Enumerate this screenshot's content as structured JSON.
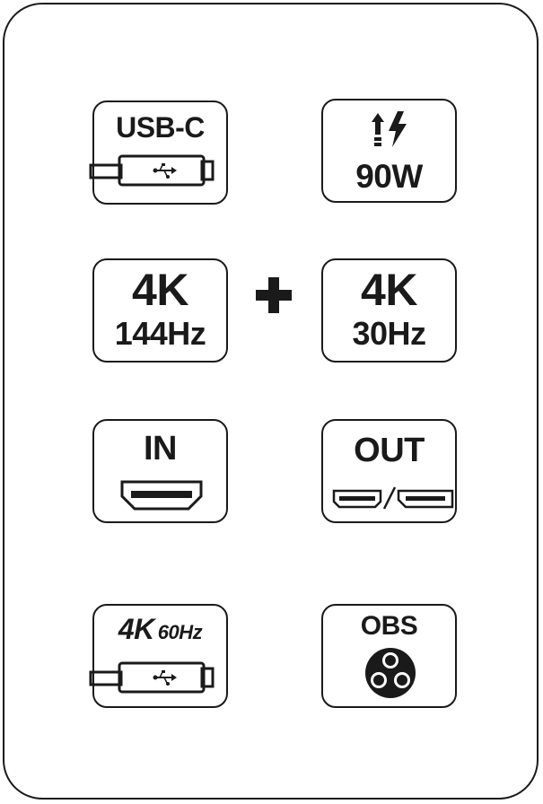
{
  "tiles": {
    "usb_c": {
      "label": "USB-C"
    },
    "power": {
      "label": "90W"
    },
    "display1": {
      "line1": "4K",
      "line2": "144Hz"
    },
    "plus": {
      "symbol": "+"
    },
    "display2": {
      "line1": "4K",
      "line2": "30Hz"
    },
    "hdmi_in": {
      "label": "IN"
    },
    "output": {
      "label": "OUT",
      "separator": "/"
    },
    "usb_4k60": {
      "label_main": "4K",
      "label_rate": "60Hz"
    },
    "obs": {
      "label": "OBS"
    }
  },
  "icons": {
    "usb_c": "usb-c-cable-icon",
    "power": "upload-power-bolt-icon",
    "hdmi_in": "hdmi-port-icon",
    "output": "hdmi-and-displayport-icon",
    "usb_4k60": "usb-c-cable-icon",
    "obs": "obs-logo-icon"
  },
  "colors": {
    "ink": "#1a1a1a",
    "background": "#ffffff"
  }
}
